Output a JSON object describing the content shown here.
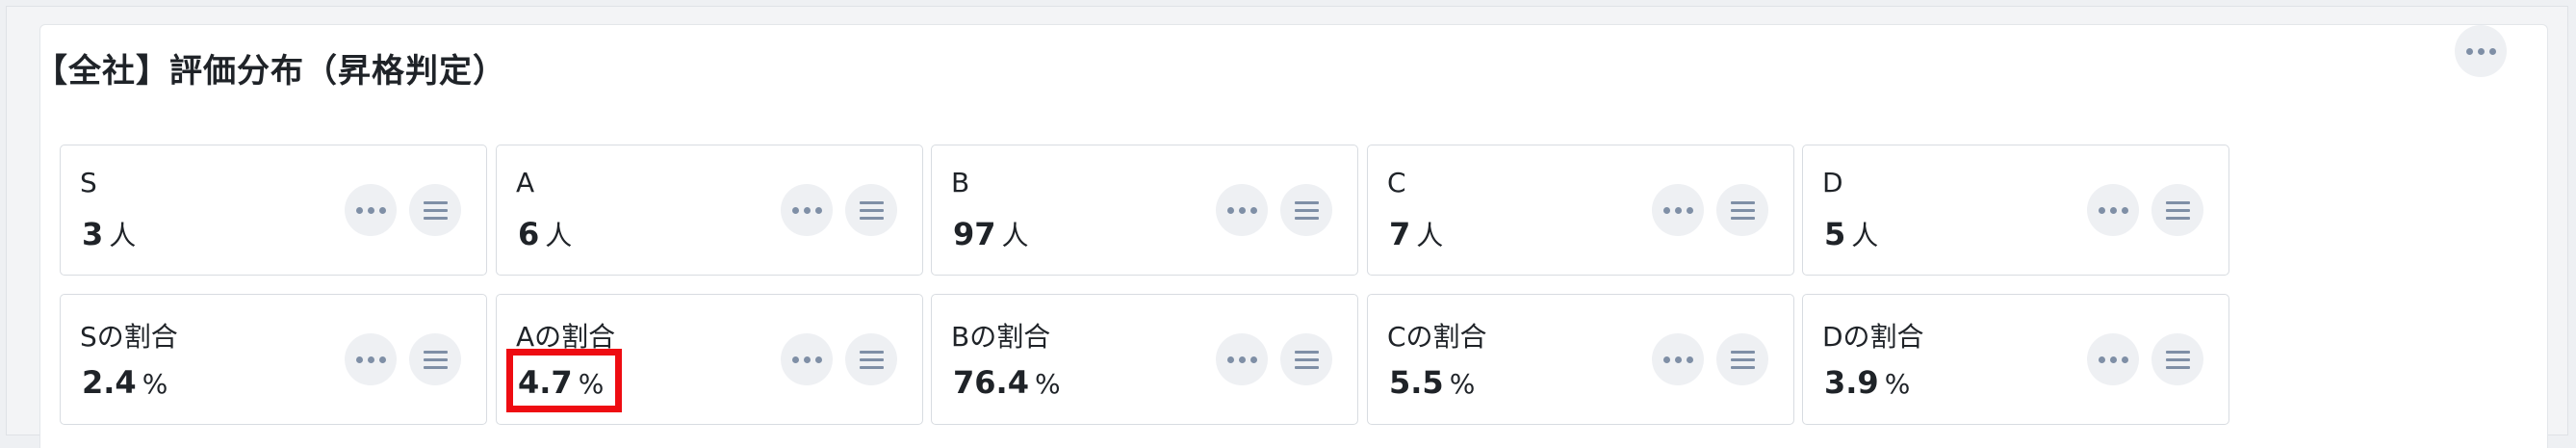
{
  "widget": {
    "title": "【全社】評価分布（昇格判定）",
    "more_icon": "more-horizontal-icon"
  },
  "count_cards": [
    {
      "label": "S",
      "value": "3",
      "unit": "人"
    },
    {
      "label": "A",
      "value": "6",
      "unit": "人"
    },
    {
      "label": "B",
      "value": "97",
      "unit": "人"
    },
    {
      "label": "C",
      "value": "7",
      "unit": "人"
    },
    {
      "label": "D",
      "value": "5",
      "unit": "人"
    }
  ],
  "ratio_cards": [
    {
      "label": "Sの割合",
      "value": "2.4",
      "unit": "%"
    },
    {
      "label": "Aの割合",
      "value": "4.7",
      "unit": "%"
    },
    {
      "label": "Bの割合",
      "value": "76.4",
      "unit": "%"
    },
    {
      "label": "Cの割合",
      "value": "5.5",
      "unit": "%"
    },
    {
      "label": "Dの割合",
      "value": "3.9",
      "unit": "%"
    }
  ],
  "card_icons": {
    "more": "more-horizontal-icon",
    "menu": "menu-lines-icon"
  },
  "colors": {
    "highlight": "#ee0c12",
    "icon": "#7f8fa6",
    "icon_bg": "#eef0f3"
  }
}
